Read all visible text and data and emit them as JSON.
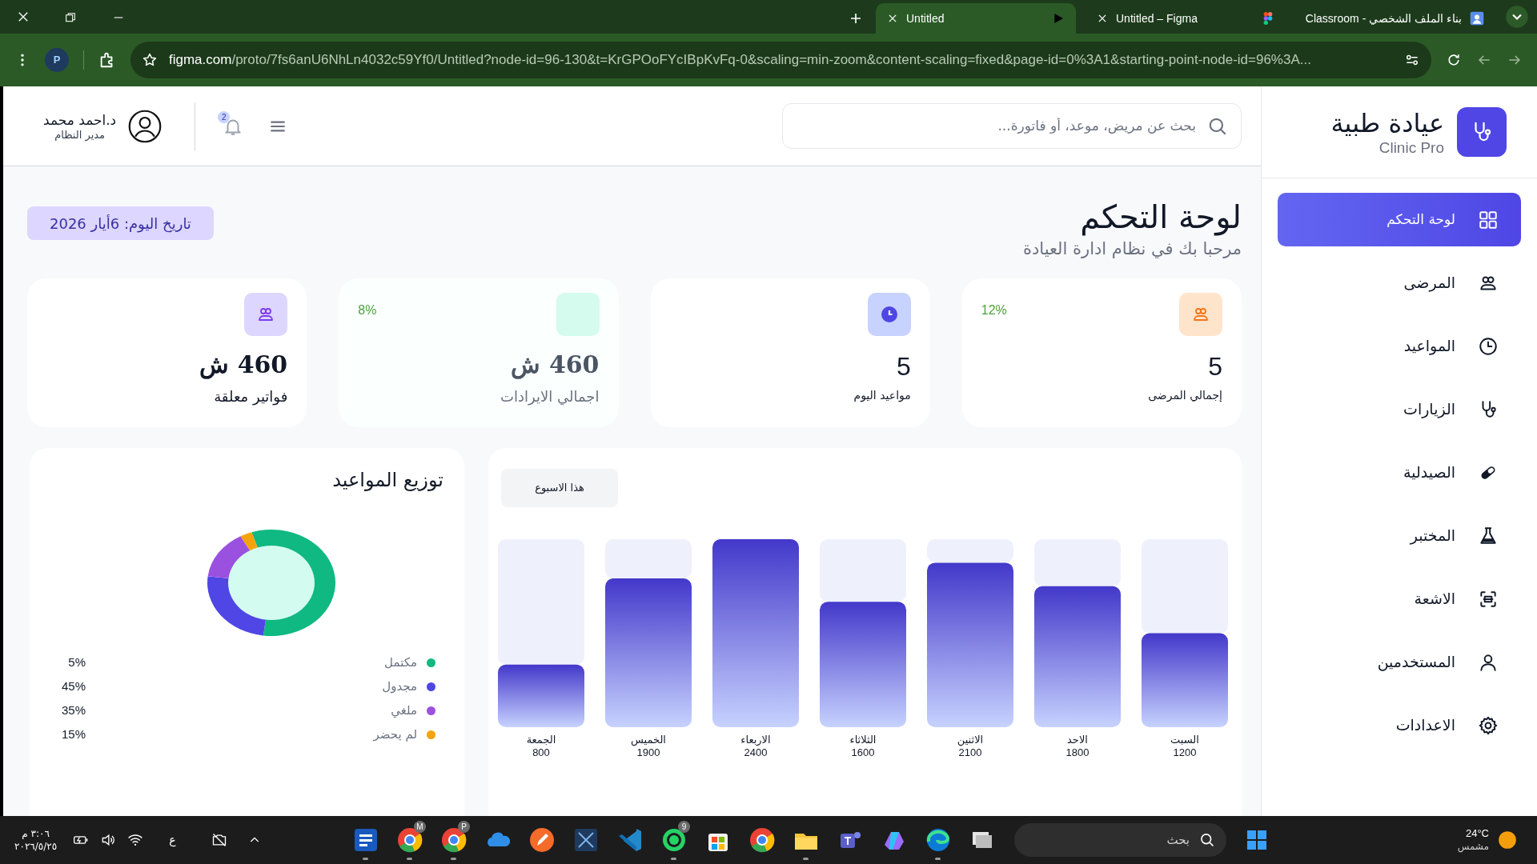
{
  "browser": {
    "tabs": [
      {
        "title": "بناء الملف الشخصي - Classroom",
        "selected": false
      },
      {
        "title": "Untitled – Figma",
        "selected": false
      },
      {
        "title": "Untitled",
        "selected": true
      }
    ],
    "profile": "P",
    "url_host": "figma.com",
    "url_rest": "/proto/7fs6anU6NhLn4032c59Yf0/Untitled?node-id=96-130&t=KrGPOoFYcIBpKvFq-0&scaling=min-zoom&content-scaling=fixed&page-id=0%3A1&starting-point-node-id=96%3A..."
  },
  "sidebar": {
    "brand_title": "عيادة طبية",
    "brand_subtitle": "Clinic Pro",
    "items": [
      {
        "label": "لوحة التحكم",
        "selected": true
      },
      {
        "label": "المرضى",
        "selected": false
      },
      {
        "label": "المواعيد",
        "selected": false
      },
      {
        "label": "الزيارات",
        "selected": false
      },
      {
        "label": "الصيدلية",
        "selected": false
      },
      {
        "label": "المختبر",
        "selected": false
      },
      {
        "label": "الاشعة",
        "selected": false
      },
      {
        "label": "المستخدمين",
        "selected": false
      },
      {
        "label": "الاعدادات",
        "selected": false
      }
    ]
  },
  "header": {
    "search": {
      "placeholder": "بحث عن مريض، موعد، أو فاتورة..."
    },
    "notification_count": "2",
    "user_name": "د.احمد محمد",
    "user_role": "مدير النظام"
  },
  "page": {
    "title": "لوحة التحكم",
    "subtitle": "مرحبا بك في نظام ادارة العيادة",
    "date_badge": "تاريخ اليوم: 6أيار 2026"
  },
  "stats": [
    {
      "kind": "count",
      "label": "إجمالي المرضى",
      "value": "5",
      "delta": "12%",
      "color": "#ffe4cc",
      "muted": false
    },
    {
      "kind": "count",
      "label": "مواعيد اليوم",
      "value": "5",
      "color": "#c7d2fe",
      "muted": false
    },
    {
      "kind": "money",
      "label": "اجمالي الايرادات",
      "value": "460 ش",
      "delta": "8%",
      "color": "#d5fbef",
      "muted": true
    },
    {
      "kind": "money",
      "label": "فواتير معلقة",
      "value": "460 ش",
      "color": "#ddd6fe",
      "muted": false
    }
  ],
  "weekly_chart": {
    "period_button": "هذا الاسبوع",
    "chart_data": {
      "type": "bar",
      "categories": [
        "الجمعة",
        "الخميس",
        "الاربعاء",
        "الثلاثاء",
        "الاثنين",
        "الاحد",
        "السبت"
      ],
      "values": [
        800,
        1900,
        2400,
        1600,
        2100,
        1800,
        1200
      ],
      "data_labels": true
    }
  },
  "distribution": {
    "title": "توزيع المواعيد",
    "legend": [
      {
        "label": "مكتمل",
        "color": "#10b981"
      },
      {
        "label": "مجدول",
        "color": "#4f46e5"
      },
      {
        "label": "ملغي",
        "color": "#9b51e0"
      },
      {
        "label": "لم يحضر",
        "color": "#f5a30b"
      }
    ],
    "percents": [
      "5%",
      "45%",
      "35%",
      "15%"
    ]
  },
  "taskbar": {
    "time": "٣:٠٦ م",
    "date": "٢٠٢٦/٥/٢٥",
    "language": "ع",
    "search_placeholder": "بحث",
    "temperature": "24°C",
    "weather": "مشمس",
    "apps": [
      {
        "kind": "window",
        "open": false
      },
      {
        "kind": "edge",
        "open": true
      },
      {
        "kind": "copilot",
        "open": false
      },
      {
        "kind": "teams",
        "open": false
      },
      {
        "kind": "folder",
        "open": true
      },
      {
        "kind": "chrome",
        "open": false
      },
      {
        "kind": "store",
        "open": false
      },
      {
        "kind": "whatsapp",
        "badge": "9",
        "open": true
      },
      {
        "kind": "code",
        "open": false
      },
      {
        "kind": "tool",
        "open": false
      },
      {
        "kind": "pen",
        "open": false
      },
      {
        "kind": "cloud",
        "open": false
      },
      {
        "kind": "chrome",
        "badge": "P",
        "open": true
      },
      {
        "kind": "chrome",
        "badge": "M",
        "open": true
      },
      {
        "kind": "word",
        "open": true
      }
    ]
  }
}
